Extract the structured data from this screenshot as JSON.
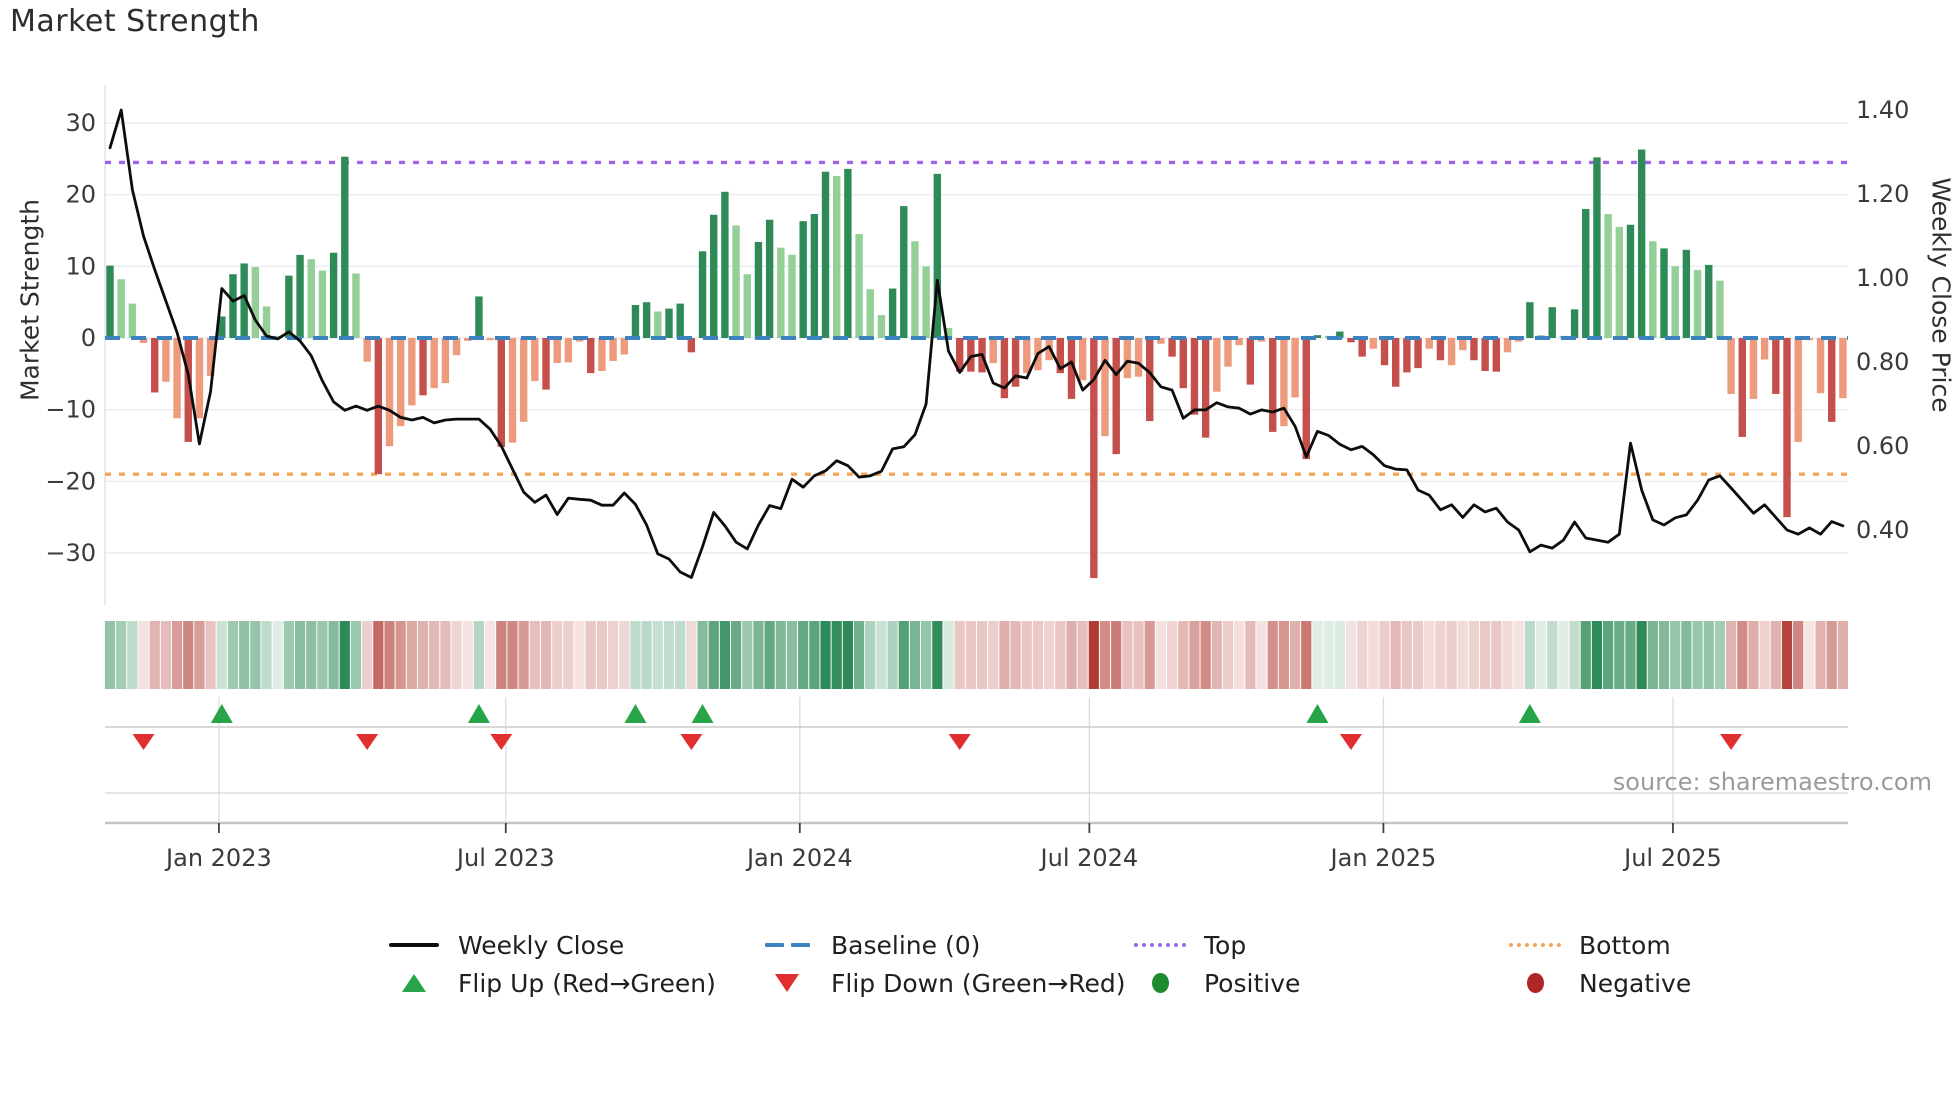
{
  "title": "Market Strength",
  "source_note": "source: sharemaestro.com",
  "axes": {
    "left_label": "Market Strength",
    "right_label": "Weekly Close Price",
    "left_ticks": [
      {
        "label": "30",
        "v": 30
      },
      {
        "label": "20",
        "v": 20
      },
      {
        "label": "10",
        "v": 10
      },
      {
        "label": "0",
        "v": 0
      },
      {
        "label": "−10",
        "v": -10
      },
      {
        "label": "−20",
        "v": -20
      },
      {
        "label": "−30",
        "v": -30
      }
    ],
    "right_ticks": [
      {
        "label": "1.40",
        "v": 1.4
      },
      {
        "label": "1.20",
        "v": 1.2
      },
      {
        "label": "1.00",
        "v": 1.0
      },
      {
        "label": "0.80",
        "v": 0.8
      },
      {
        "label": "0.60",
        "v": 0.6
      },
      {
        "label": "0.40",
        "v": 0.4
      }
    ],
    "x_ticks": [
      {
        "label": "Jan 2023",
        "week": 9.74
      },
      {
        "label": "Jul 2023",
        "week": 35.4
      },
      {
        "label": "Jan 2024",
        "week": 61.7
      },
      {
        "label": "Jul 2024",
        "week": 87.6
      },
      {
        "label": "Jan 2025",
        "week": 113.9
      },
      {
        "label": "Jul 2025",
        "week": 139.8
      }
    ]
  },
  "legend": {
    "items": [
      {
        "label": "Weekly Close",
        "type": "line"
      },
      {
        "label": "Baseline (0)",
        "type": "dashes"
      },
      {
        "label": "Top",
        "type": "dots-purple"
      },
      {
        "label": "Bottom",
        "type": "dots-orange"
      },
      {
        "label": "Flip Up (Red→Green)",
        "type": "triangle-up"
      },
      {
        "label": "Flip Down (Green→Red)",
        "type": "triangle-down"
      },
      {
        "label": "Positive",
        "type": "circle-green"
      },
      {
        "label": "Negative",
        "type": "circle-red"
      }
    ]
  },
  "chart_data": {
    "type": "bar+line combo with heatmap strip and flip markers",
    "x_unit": "weeks",
    "left_axis_range": [
      -35,
      35
    ],
    "right_axis_range": [
      0.3,
      1.45
    ],
    "grid": "horizontal only",
    "baseline": 0,
    "top_threshold": 24.5,
    "bottom_threshold": -19.0,
    "bars": {
      "name": "Market Strength",
      "values": [
        10.1,
        8.2,
        4.8,
        -0.7,
        -7.6,
        -6.1,
        -11.2,
        -14.5,
        -11.2,
        -5.3,
        3.0,
        8.9,
        10.4,
        9.9,
        4.4,
        0.3,
        8.7,
        11.6,
        11.0,
        9.4,
        11.9,
        25.3,
        9.0,
        -3.3,
        -19.0,
        -15.1,
        -12.3,
        -9.4,
        -8.0,
        -7.0,
        -6.3,
        -2.4,
        -0.4,
        5.8,
        -0.3,
        -15.2,
        -14.6,
        -11.7,
        -6.0,
        -7.2,
        -3.5,
        -3.4,
        -0.5,
        -4.9,
        -4.6,
        -3.2,
        -2.3,
        4.6,
        5.0,
        3.7,
        4.1,
        4.8,
        -2.0,
        12.1,
        17.2,
        20.4,
        15.7,
        8.9,
        13.4,
        16.5,
        12.6,
        11.6,
        16.3,
        17.3,
        23.2,
        22.6,
        23.6,
        14.5,
        6.8,
        3.2,
        6.9,
        18.4,
        13.5,
        10.0,
        22.9,
        1.4,
        -4.7,
        -4.7,
        -4.8,
        -3.5,
        -8.4,
        -6.8,
        -4.9,
        -4.5,
        -3.1,
        -4.9,
        -8.5,
        -5.9,
        -33.5,
        -13.7,
        -16.2,
        -5.6,
        -5.4,
        -11.6,
        -0.8,
        -2.6,
        -7.0,
        -10.7,
        -13.9,
        -7.5,
        -4.0,
        -1.0,
        -6.5,
        -0.5,
        -13.1,
        -12.3,
        -8.3,
        -16.9,
        0.4,
        0.3,
        0.9,
        -0.6,
        -2.6,
        -1.5,
        -3.8,
        -6.8,
        -4.8,
        -4.2,
        -1.5,
        -3.1,
        -3.8,
        -1.7,
        -3.1,
        -4.6,
        -4.7,
        -2.0,
        -0.5,
        5.0,
        0.4,
        4.3,
        0.3,
        4.0,
        18.0,
        25.2,
        17.3,
        15.5,
        15.8,
        26.3,
        13.5,
        12.5,
        10.0,
        12.3,
        9.5,
        10.2,
        8.0,
        -7.8,
        -13.8,
        -8.5,
        -3.0,
        -7.8,
        -25.0,
        -14.5,
        -0.3,
        -7.7,
        -11.7,
        -8.4
      ],
      "shades": [
        "dg",
        "lg",
        "lg",
        "s",
        "dr",
        "s",
        "s",
        "dr",
        "s",
        "s",
        "dg",
        "dg",
        "dg",
        "lg",
        "lg",
        "lg",
        "dg",
        "dg",
        "lg",
        "lg",
        "dg",
        "dg",
        "lg",
        "s",
        "dr",
        "s",
        "s",
        "s",
        "dr",
        "s",
        "s",
        "s",
        "s",
        "dg",
        "s",
        "dr",
        "s",
        "s",
        "s",
        "dr",
        "s",
        "s",
        "s",
        "dr",
        "s",
        "s",
        "s",
        "dg",
        "dg",
        "lg",
        "dg",
        "dg",
        "dr",
        "dg",
        "dg",
        "dg",
        "lg",
        "lg",
        "dg",
        "dg",
        "lg",
        "lg",
        "dg",
        "dg",
        "dg",
        "lg",
        "dg",
        "lg",
        "lg",
        "lg",
        "dg",
        "dg",
        "lg",
        "lg",
        "dg",
        "lg",
        "dr",
        "dr",
        "dr",
        "s",
        "dr",
        "dr",
        "s",
        "s",
        "s",
        "dr",
        "dr",
        "s",
        "dr",
        "s",
        "dr",
        "s",
        "s",
        "dr",
        "s",
        "dr",
        "dr",
        "dr",
        "dr",
        "s",
        "s",
        "s",
        "dr",
        "s",
        "dr",
        "s",
        "s",
        "dr",
        "dg",
        "lg",
        "dg",
        "dr",
        "dr",
        "s",
        "dr",
        "dr",
        "dr",
        "dr",
        "s",
        "dr",
        "s",
        "s",
        "dr",
        "dr",
        "dr",
        "s",
        "s",
        "dg",
        "lg",
        "dg",
        "lg",
        "dg",
        "dg",
        "dg",
        "lg",
        "lg",
        "dg",
        "dg",
        "lg",
        "dg",
        "lg",
        "dg",
        "lg",
        "dg",
        "lg",
        "s",
        "dr",
        "s",
        "s",
        "dr",
        "dr",
        "s",
        "s",
        "s",
        "dr",
        "s"
      ]
    },
    "line": {
      "name": "Weekly Close",
      "values": [
        1.31,
        1.4,
        1.21,
        1.1,
        1.02,
        0.945,
        0.87,
        0.77,
        0.605,
        0.73,
        0.975,
        0.945,
        0.958,
        0.9,
        0.862,
        0.855,
        0.872,
        0.85,
        0.815,
        0.755,
        0.705,
        0.685,
        0.695,
        0.685,
        0.695,
        0.685,
        0.668,
        0.662,
        0.668,
        0.655,
        0.662,
        0.664,
        0.664,
        0.664,
        0.64,
        0.6,
        0.545,
        0.49,
        0.466,
        0.483,
        0.437,
        0.476,
        0.473,
        0.471,
        0.459,
        0.459,
        0.488,
        0.461,
        0.412,
        0.343,
        0.331,
        0.3,
        0.287,
        0.36,
        0.442,
        0.41,
        0.371,
        0.355,
        0.412,
        0.458,
        0.451,
        0.521,
        0.502,
        0.529,
        0.541,
        0.565,
        0.553,
        0.526,
        0.529,
        0.54,
        0.593,
        0.598,
        0.627,
        0.7,
        0.995,
        0.826,
        0.775,
        0.813,
        0.818,
        0.75,
        0.738,
        0.767,
        0.762,
        0.82,
        0.837,
        0.784,
        0.8,
        0.733,
        0.758,
        0.804,
        0.77,
        0.802,
        0.797,
        0.775,
        0.741,
        0.733,
        0.666,
        0.686,
        0.686,
        0.703,
        0.693,
        0.69,
        0.676,
        0.686,
        0.681,
        0.69,
        0.647,
        0.574,
        0.635,
        0.625,
        0.604,
        0.591,
        0.599,
        0.579,
        0.553,
        0.545,
        0.543,
        0.495,
        0.483,
        0.448,
        0.46,
        0.43,
        0.46,
        0.443,
        0.452,
        0.419,
        0.4,
        0.348,
        0.364,
        0.357,
        0.376,
        0.419,
        0.381,
        0.376,
        0.371,
        0.39,
        0.607,
        0.495,
        0.424,
        0.412,
        0.429,
        0.436,
        0.471,
        0.519,
        0.529,
        0.5,
        0.47,
        0.44,
        0.46,
        0.43,
        0.4,
        0.39,
        0.405,
        0.39,
        0.42,
        0.41
      ]
    },
    "heatmap": {
      "description": "one cell per week, white→green for positive strength, white→red for negative strength"
    },
    "flip_up_weeks": [
      10,
      33,
      47,
      53,
      108,
      127
    ],
    "flip_down_weeks": [
      3,
      23,
      35,
      52,
      76,
      111,
      145
    ]
  },
  "colors": {
    "dark_green": "#2e8b57",
    "light_green": "#93cf96",
    "salmon": "#ee9a7c",
    "dark_red": "#c5504b",
    "baseline_blue": "#3c82bf",
    "top_purple": "#9f63e3",
    "bottom_orange": "#f4a65a",
    "line_black": "#0d0d0d",
    "grid": "#ebebf2",
    "spine": "#c9c9cd",
    "flip_up": "#27a348",
    "flip_down": "#e12f2f",
    "positive_dot": "#1e8b2e",
    "negative_dot": "#b02626",
    "tick_text": "#3a3a3a",
    "source_text": "#9b9b9b",
    "heat_green_rgb": [
      46,
      139,
      87
    ],
    "heat_red_rgb": [
      177,
      60,
      52
    ]
  }
}
